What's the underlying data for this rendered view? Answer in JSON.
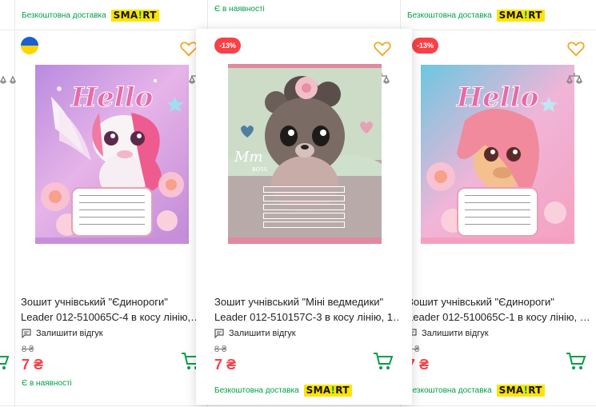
{
  "delivery_text": "Безкоштовна доставка",
  "smart_logo": "SMART",
  "colors": {
    "accent_green": "#00a046",
    "price_red": "#f84147",
    "smart_yellow": "#ffe400"
  },
  "products": [
    {
      "title_line1": "Зошит учнівський \"Єдинороги\"",
      "title_line2": "Leader 012-510065С-4 в косу лінію,…",
      "review": "Залишити відгук",
      "old_price": "8 ₴",
      "price": "7 ₴",
      "availability": "Є в наявності"
    },
    {
      "top_availability": "Є в наявності",
      "discount": "-13%",
      "cover_text": "Mm BOSS",
      "title_line1": "Зошит учнівський \"Міні ведмедики\"",
      "title_line2": "Leader 012-510157С-3 в косу лінію, 1…",
      "review": "Залишити відгук",
      "old_price": "8 ₴",
      "price": "7 ₴"
    },
    {
      "discount": "-13%",
      "title_line1": "Зошит учнівський \"Єдинороги\"",
      "title_line2": "Leader 012-510065С-1 в косу лінію, …",
      "review": "Залишити відгук",
      "old_price": "8 ₴",
      "price": "7 ₴"
    }
  ],
  "icons": [
    "ukraine-flag-icon",
    "heart-icon",
    "compare-scales-icon",
    "comment-icon",
    "cart-icon"
  ]
}
